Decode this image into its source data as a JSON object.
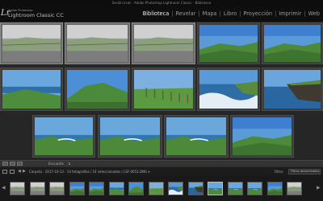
{
  "window": {
    "title": "Sesión.lrcat - Adobe Photoshop Lightroom Classic - Biblioteca"
  },
  "identity": {
    "badge": "Lr",
    "brand_small": "Adobe Photoshop",
    "brand_large": "Lightroom Classic CC"
  },
  "modules": [
    {
      "label": "Biblioteca",
      "active": true
    },
    {
      "label": "Revelar",
      "active": false
    },
    {
      "label": "Mapa",
      "active": false
    },
    {
      "label": "Libro",
      "active": false
    },
    {
      "label": "Proyección",
      "active": false
    },
    {
      "label": "Imprimir",
      "active": false
    },
    {
      "label": "Web",
      "active": false
    }
  ],
  "grid": {
    "photos": [
      {
        "scene": "bw-field",
        "selected": true
      },
      {
        "scene": "bw-field",
        "selected": true
      },
      {
        "scene": "bw-field",
        "selected": true
      },
      {
        "scene": "meadow",
        "selected": false
      },
      {
        "scene": "meadow",
        "selected": false
      },
      {
        "scene": "coast",
        "selected": false
      },
      {
        "scene": "hill",
        "selected": false
      },
      {
        "scene": "fence",
        "selected": false
      },
      {
        "scene": "waves",
        "selected": false
      },
      {
        "scene": "cliff",
        "selected": false
      },
      {
        "scene": "bay",
        "selected": false
      },
      {
        "scene": "bay",
        "selected": false
      },
      {
        "scene": "bay",
        "selected": false
      },
      {
        "scene": "meadow",
        "selected": false
      }
    ]
  },
  "toolbar": {
    "sort_label": "Encuadre",
    "sort_indicator": "⇅"
  },
  "filmstrip": {
    "path": "Carpeta · 2017-10-13 · 14 fotografías / 14 seleccionadas / LSF-0051.DNG ▾",
    "filter_label": "Filtro:",
    "filter_value": "Filtros desactivados",
    "thumbnails": [
      "bw-field",
      "bw-field",
      "bw-field",
      "meadow",
      "meadow",
      "coast",
      "hill",
      "fence",
      "waves",
      "cliff",
      "bay",
      "bay",
      "bay",
      "meadow",
      "bw-field"
    ],
    "current_index": 10
  },
  "icons": {
    "left_arrow": "◀",
    "right_arrow": "▶",
    "corner_badge": "✕"
  }
}
